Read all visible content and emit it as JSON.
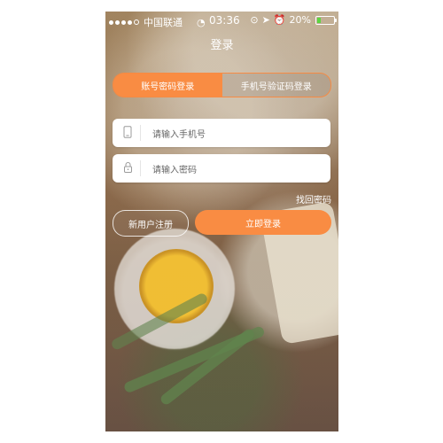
{
  "status_bar": {
    "carrier": "中国联通",
    "time": "03:36",
    "battery_percent": "20%",
    "battery_level": 0.2
  },
  "header": {
    "title": "登录"
  },
  "tabs": [
    {
      "label": "账号密码登录",
      "active": true
    },
    {
      "label": "手机号验证码登录",
      "active": false
    }
  ],
  "form": {
    "phone_placeholder": "请输入手机号",
    "password_placeholder": "请输入密码",
    "forgot_password_label": "找回密码"
  },
  "actions": {
    "register_label": "新用户注册",
    "login_label": "立即登录"
  },
  "colors": {
    "accent": "#f98c43",
    "battery": "#5bd642"
  },
  "icons": {
    "wifi": "wifi-icon",
    "phone": "phone-icon",
    "lock": "lock-icon",
    "location": "location-icon",
    "alarm": "alarm-icon",
    "rotation_lock": "rotation-lock-icon"
  }
}
